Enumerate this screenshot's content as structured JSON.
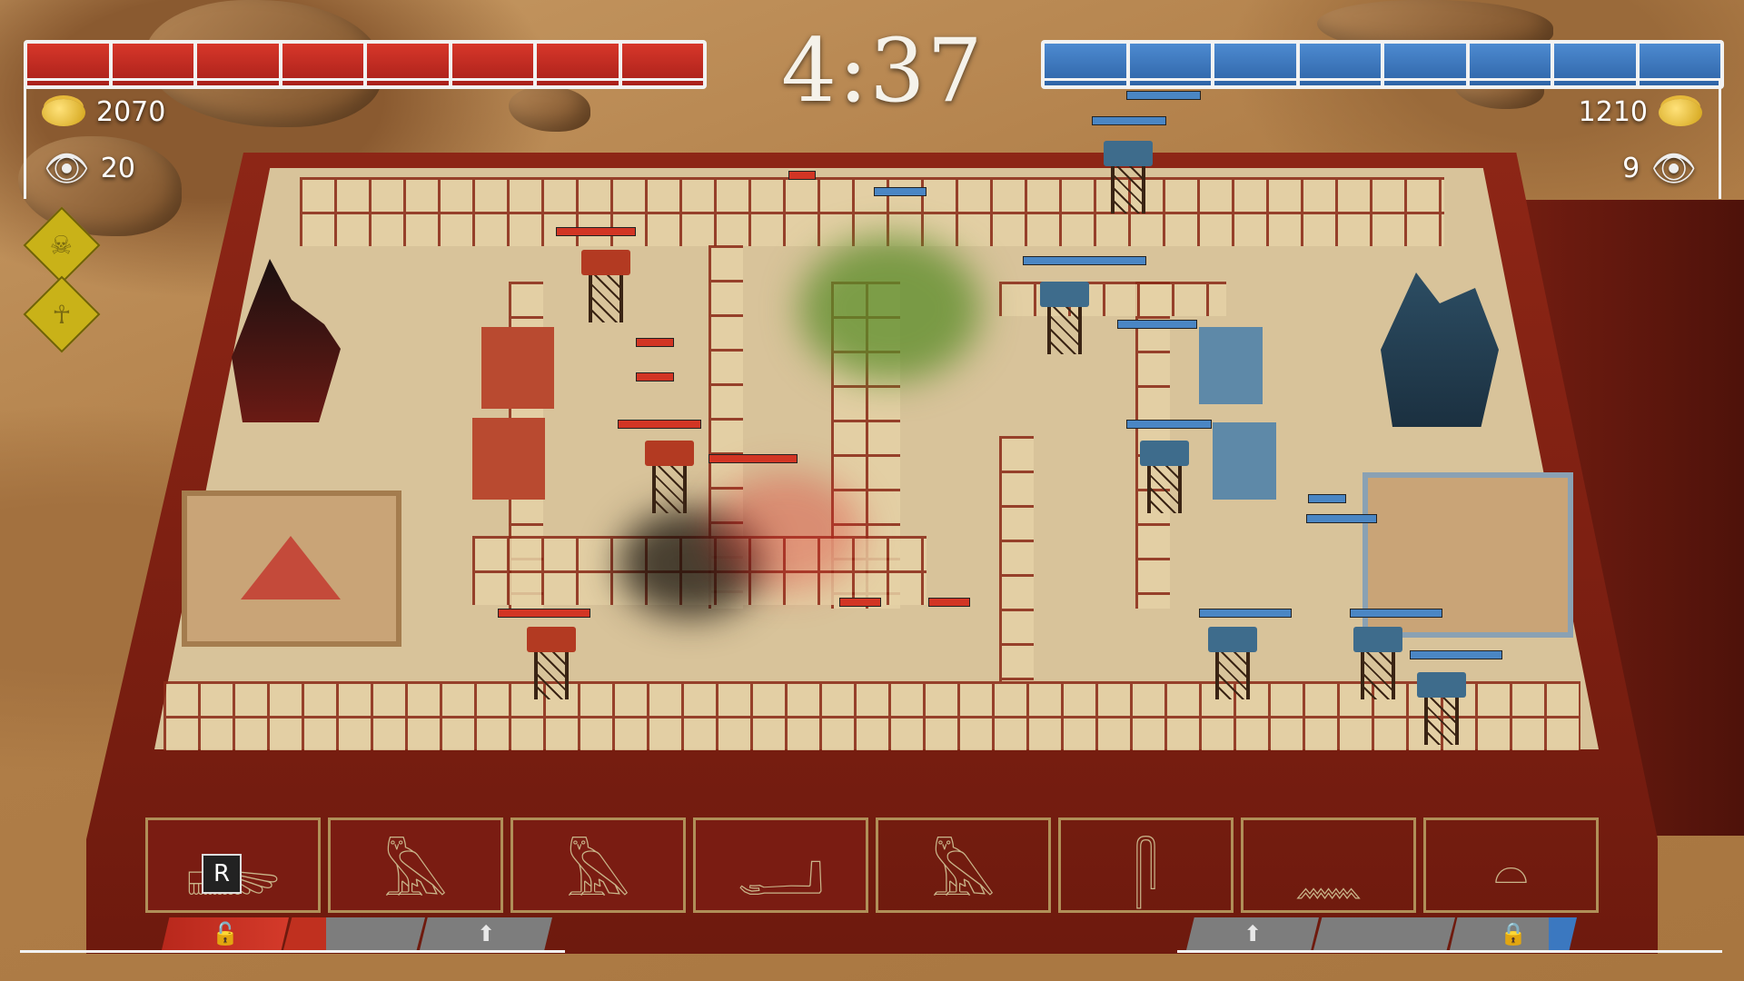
{
  "timer": "4:37",
  "player_red": {
    "gold": "2070",
    "vision": "20",
    "health_segments": 8,
    "color": "#c62a1e"
  },
  "player_blue": {
    "gold": "1210",
    "vision": "9",
    "health_segments": 8,
    "color": "#3b78c0"
  },
  "abilities": [
    {
      "name": "skull-ability-icon",
      "glyph": "☠"
    },
    {
      "name": "ankh-ability-icon",
      "glyph": "☥"
    }
  ],
  "hotkey": "R",
  "bottom_left_slots": [
    {
      "icon": "🔓",
      "state": "unlocked",
      "fill": 1.0
    },
    {
      "icon": "",
      "state": "partial",
      "fill": 0.3
    },
    {
      "icon": "⬆",
      "state": "upgrade",
      "fill": 0
    }
  ],
  "bottom_right_slots": [
    {
      "icon": "⬆",
      "state": "upgrade",
      "fill": 0
    },
    {
      "icon": "",
      "state": "empty",
      "fill": 0
    },
    {
      "icon": "🔒",
      "state": "locked",
      "fill": 0.2
    }
  ],
  "hieroglyph_panels": [
    {
      "glyph": "𓆃",
      "team": "red"
    },
    {
      "glyph": "𓅓",
      "team": "red"
    },
    {
      "glyph": "𓅓",
      "team": "red"
    },
    {
      "glyph": "𓂝",
      "team": "red"
    },
    {
      "glyph": "𓅓",
      "team": "blue"
    },
    {
      "glyph": "𓋴",
      "team": "blue"
    },
    {
      "glyph": "𓈖",
      "team": "blue"
    },
    {
      "glyph": "𓏏",
      "team": "blue"
    }
  ],
  "colors": {
    "red_team": "#c62a1e",
    "blue_team": "#3b78c0",
    "board_wood": "#8e2616",
    "sand_floor": "#d8c39a",
    "hud_white": "#f2f2f2"
  }
}
